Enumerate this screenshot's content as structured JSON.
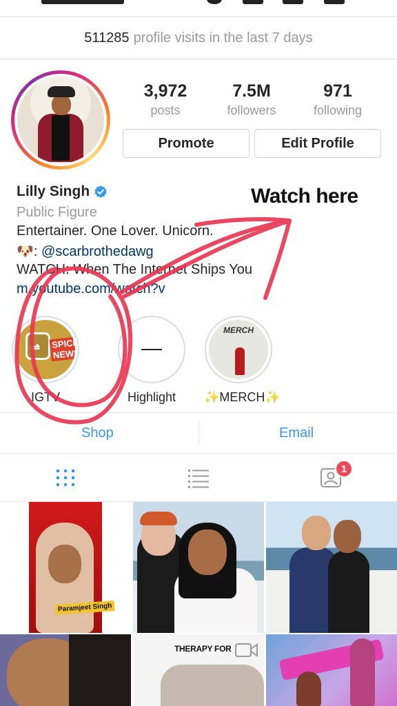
{
  "profile_visits": {
    "count": "511285",
    "label": "profile visits in the last 7 days"
  },
  "stats": [
    {
      "value": "3,972",
      "label": "posts"
    },
    {
      "value": "7.5M",
      "label": "followers"
    },
    {
      "value": "971",
      "label": "following"
    }
  ],
  "buttons": {
    "promote": "Promote",
    "edit_profile": "Edit Profile"
  },
  "profile": {
    "name": "Lilly Singh",
    "category": "Public Figure",
    "bio_line1": "Entertainer. One Lover. Unicorn.",
    "bio_emoji": "🐶",
    "bio_mention_prefix": ": ",
    "bio_mention": "@scarbrothedawg",
    "bio_line3": "WATCH: When The Internet Ships You",
    "bio_link": "m.youtube.com/watch?v"
  },
  "annotation": {
    "watch_here": "Watch here",
    "color": "#e8344f"
  },
  "highlights": [
    {
      "label": "IGTV",
      "tag": "SPICE NEWS"
    },
    {
      "label": "Highlight"
    },
    {
      "label": "✨MERCH✨",
      "cover_text": "MERCH"
    }
  ],
  "contact": {
    "shop": "Shop",
    "email": "Email"
  },
  "tabs": {
    "notification_count": "1"
  },
  "posts": {
    "post1_caption": "Paramjeet Singh",
    "post5_text": "THERAPY FOR"
  },
  "colors": {
    "accent": "#3897f0",
    "badge": "#ed4956",
    "link": "#003569"
  }
}
